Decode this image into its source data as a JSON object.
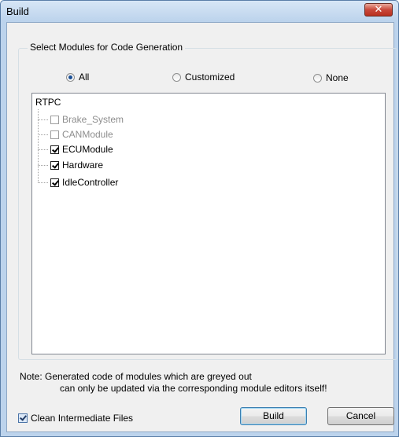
{
  "window": {
    "title": "Build",
    "close_glyph": "✕"
  },
  "group": {
    "legend": "Select Modules for Code Generation"
  },
  "radios": [
    {
      "label": "All",
      "selected": true
    },
    {
      "label": "Customized",
      "selected": false
    },
    {
      "label": "None",
      "selected": false
    }
  ],
  "tree": {
    "root": "RTPC",
    "items": [
      {
        "label": "Brake_System",
        "checked": false,
        "greyed": true
      },
      {
        "label": "CANModule",
        "checked": false,
        "greyed": true
      },
      {
        "label": "ECUModule",
        "checked": true,
        "greyed": false
      },
      {
        "label": "Hardware",
        "checked": true,
        "greyed": false
      },
      {
        "label": "IdleController",
        "checked": true,
        "greyed": false
      }
    ]
  },
  "note": {
    "line1": "Note: Generated code of modules which are greyed out",
    "line2": "can only be updated via the corresponding module editors itself!"
  },
  "clean": {
    "label": "Clean Intermediate Files",
    "checked": true
  },
  "buttons": {
    "build": "Build",
    "cancel": "Cancel"
  }
}
